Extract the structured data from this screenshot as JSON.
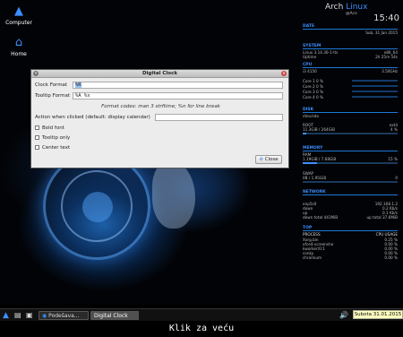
{
  "desktop": {
    "icons": [
      {
        "label": "Computer",
        "icon": "arch-logo-icon"
      },
      {
        "label": "Home",
        "icon": "home-folder-icon"
      }
    ]
  },
  "conky": {
    "os_name": "Arch",
    "os_name_accent": "Linux",
    "user": "@Aco",
    "time": "15:40",
    "date_section": "DATE",
    "date": "Sub, 31 Jan 2015",
    "system_section": "SYSTEM",
    "kernel": "Linux 3.14.30-1-lts",
    "arch": "x86_64",
    "uptime_label": "Uptime",
    "uptime": "2h 25m 54s",
    "cpu_section": "CPU",
    "cpu_name": "i3 4150",
    "cpu_freq": "3.50GHz",
    "cores": [
      "Core 1  0 %",
      "Core 2  0 %",
      "Core 3  0 %",
      "Core 4  0 %"
    ],
    "disk_section": "DISK",
    "disk_name": "/dev/sda",
    "root_label": "ROOT",
    "root_fs": "ext4",
    "root_usage": "11.3GiB / 264GiB",
    "root_pct": "4 %",
    "root_fill": 0.04,
    "memory_section": "MEMORY",
    "ram_label": "RAM",
    "ram_usage": "1.19GiB / 7.68GiB",
    "ram_pct": "15 %",
    "ram_fill": 0.15,
    "swap_label": "SWAP",
    "swap_usage": "0B / 1.95GiB",
    "swap_pct": "0",
    "network_section": "NETWORK",
    "iface": "enp5s0",
    "ip": "192.168.1.2",
    "down_label": "down",
    "down_val": "0.2 Kb/s",
    "up_label": "up",
    "up_val": "0.1 Kb/s",
    "down_total": "down total 441MiB",
    "up_total": "up total 37.6MiB",
    "top_section": "TOP",
    "process_header": "PROCESS",
    "cpu_usage_header": "CPU USAGE",
    "processes": [
      {
        "name": "Xorg.bin",
        "cpu": "0.25 %"
      },
      {
        "name": "xfce4-screensho",
        "cpu": "0.00 %"
      },
      {
        "name": "kworker/0:1",
        "cpu": "0.00 %"
      },
      {
        "name": "conky",
        "cpu": "0.00 %"
      },
      {
        "name": "chromium",
        "cpu": "0.00 %"
      }
    ]
  },
  "dialog": {
    "title": "Digital Clock",
    "clock_format_label": "Clock Format",
    "clock_format_value": "%R",
    "tooltip_format_label": "Tooltip Format",
    "tooltip_format_value": "%A %x",
    "hint": "Format codes: man 3 strftime; %n for line break",
    "action_label": "Action when clicked (default: display calendar)",
    "action_value": "",
    "bold_font_label": "Bold font",
    "tooltip_only_label": "Tooltip only",
    "center_text_label": "Center text",
    "close_label": "Close"
  },
  "taskbar": {
    "tasks": [
      "Podešava...",
      "Digital Clock"
    ],
    "clock": "Subota 31.01.2015"
  },
  "footer_text": "Klik za veću",
  "colors": {
    "accent": "#3d8eff",
    "dialog_bg": "#ececec"
  }
}
